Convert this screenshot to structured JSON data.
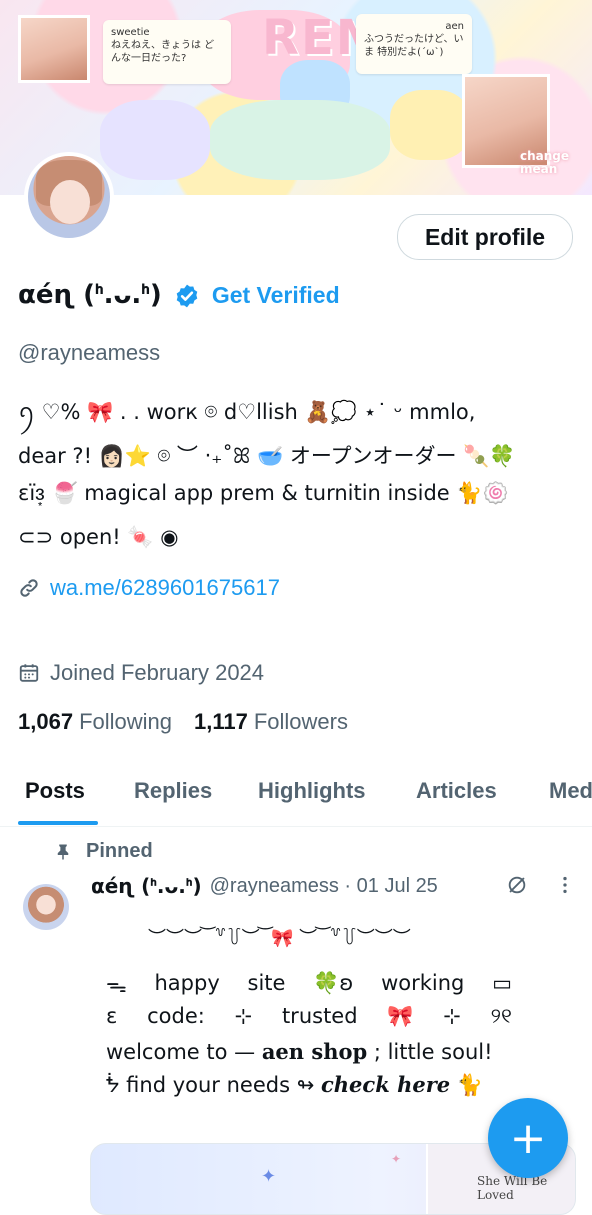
{
  "banner": {
    "note_left_name": "sweetie",
    "note_left_text": "ねえねえ、きょうは どんな一日だった?",
    "note_right_name": "aen",
    "note_right_text": "ふつうだったけど、いま 特別だよ(´ω`)",
    "big_text": "REM",
    "corner_text": "change mean"
  },
  "profile": {
    "edit_button": "Edit profile",
    "display_name": "αéɳ (ᑋ.ᴗ.ᑋ)",
    "get_verified": "Get Verified",
    "handle": "@rayneamess",
    "bio_lines": [
      "ꪆ ♡% 🎀 . . worк ⌾ d♡llish 🧸💭 ⋆˙ ᵕ mmlo,",
      "dear ?! 👩🏻⭐ ⌾ ︶ ‧₊˚ꕤ 🥣 オープンオーダー 🍡🍀",
      "ɛïɜ͙  🍧 magical app prem & turnitin inside 🐈🍥",
      "⊂⊃ open! 🍬 ◉"
    ],
    "link": "wa.me/6289601675617",
    "joined": "Joined February 2024",
    "following_count": "1,067",
    "following_label": "Following",
    "followers_count": "1,117",
    "followers_label": "Followers"
  },
  "tabs": [
    "Posts",
    "Replies",
    "Highlights",
    "Articles",
    "Media"
  ],
  "post": {
    "pinned_label": "Pinned",
    "author_name": "αéɳ (ᑋ.ᴗ.ᑋ)",
    "meta": "@rayneamess · 01 Jul 25",
    "line1": "︶︶︶ ͝ ꒷꒦︶ ͝ 🎀 ︶ ͝ ꒷꒦︶︶︶",
    "line2": [
      "ᯓ",
      "happy",
      "site",
      "🍀ʚ",
      "working",
      "▭"
    ],
    "line3": [
      "ɛ",
      "code:",
      "⊹",
      "trusted",
      "🎀",
      "⊹",
      "୨୧"
    ],
    "line4_pre": "welcome to —",
    "line4_bold": "aen shop",
    "line4_post": "; little soul!",
    "line5_pre": "ᖭ  find your needs ↬",
    "line5_bold": "check here",
    "line5_emoji": "🐈",
    "media_text": "She Will Be Loved"
  },
  "fab_label": "+",
  "colors": {
    "accent": "#1d9bf0",
    "text": "#0f1419",
    "muted": "#536471",
    "border": "#cfd9de"
  }
}
